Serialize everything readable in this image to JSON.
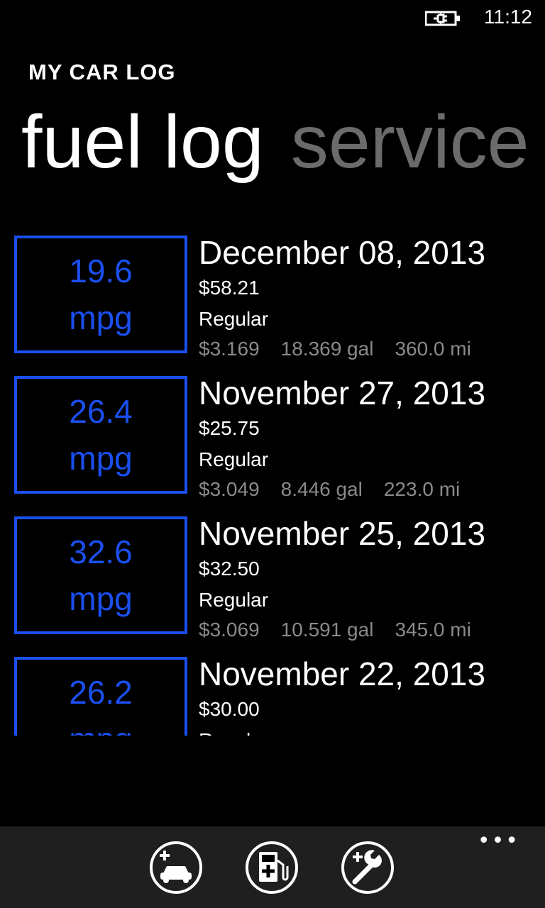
{
  "status": {
    "time": "11:12",
    "battery_icon": "battery-charging-icon"
  },
  "app": {
    "title": "MY CAR LOG"
  },
  "pivot": {
    "items": [
      "fuel log",
      "service"
    ],
    "active_index": 0
  },
  "entries": [
    {
      "mpg": "19.6",
      "unit": "mpg",
      "date": "December 08, 2013",
      "cost": "$58.21",
      "grade": "Regular",
      "price": "$3.169",
      "gallons": "18.369 gal",
      "miles": "360.0 mi"
    },
    {
      "mpg": "26.4",
      "unit": "mpg",
      "date": "November 27, 2013",
      "cost": "$25.75",
      "grade": "Regular",
      "price": "$3.049",
      "gallons": "8.446 gal",
      "miles": "223.0 mi"
    },
    {
      "mpg": "32.6",
      "unit": "mpg",
      "date": "November 25, 2013",
      "cost": "$32.50",
      "grade": "Regular",
      "price": "$3.069",
      "gallons": "10.591 gal",
      "miles": "345.0 mi"
    },
    {
      "mpg": "26.2",
      "unit": "mpg",
      "date": "November 22, 2013",
      "cost": "$30.00",
      "grade": "Regular",
      "price": "",
      "gallons": "",
      "miles": ""
    }
  ],
  "app_bar": {
    "buttons": [
      "add-car-icon",
      "add-fuel-icon",
      "add-service-icon"
    ],
    "more": "•••"
  },
  "colors": {
    "accent": "#1a4ff0",
    "background": "#000000",
    "inactive_pivot": "#6b6b6b",
    "secondary_text": "#8a8a8a",
    "app_bar": "#1f1f1f"
  }
}
